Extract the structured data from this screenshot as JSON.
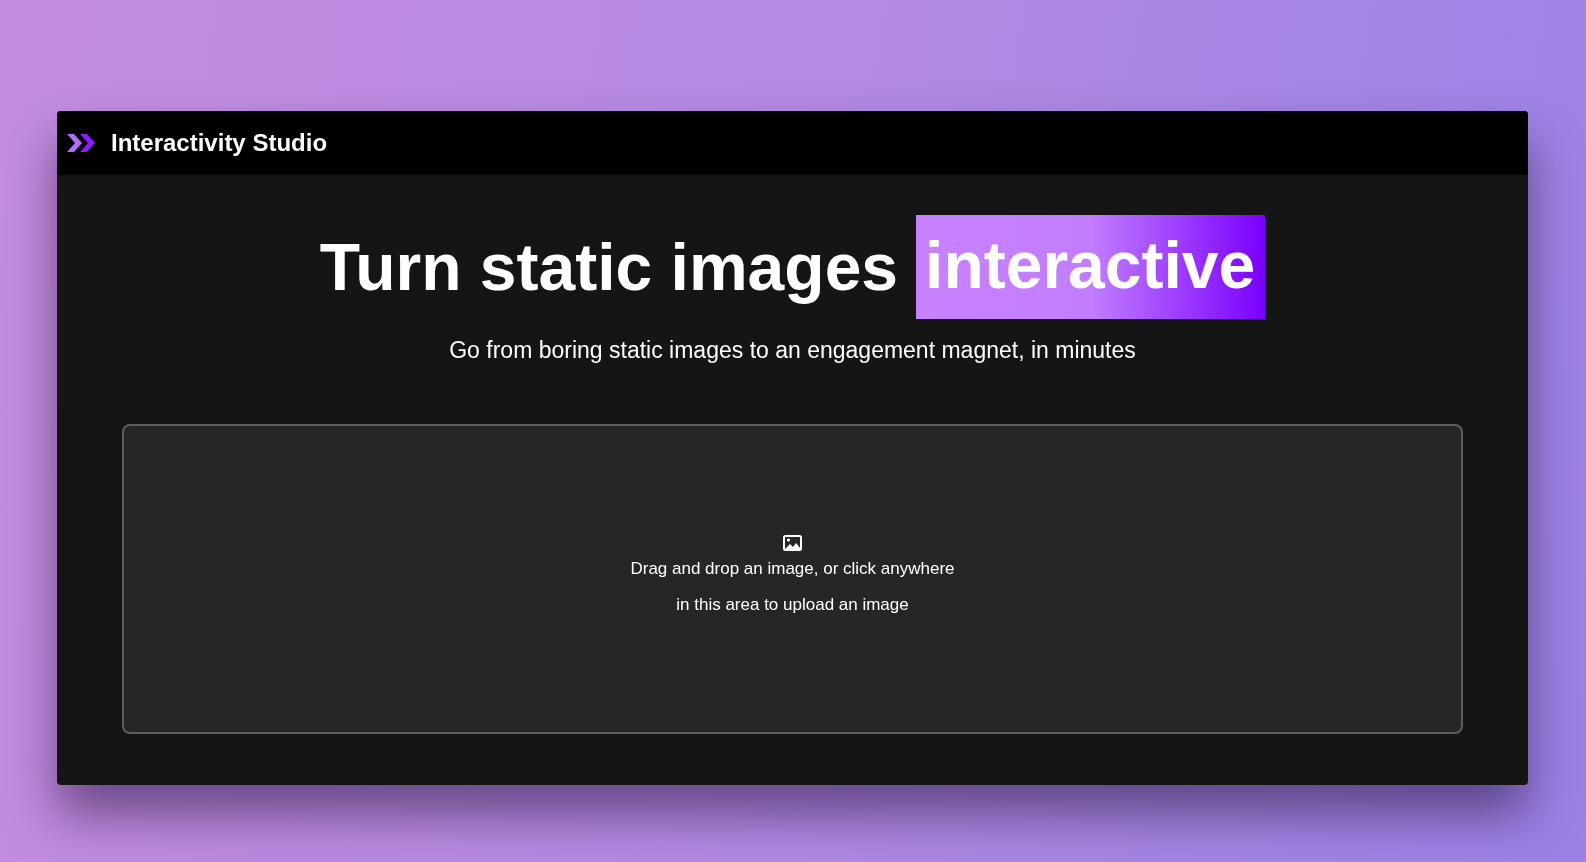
{
  "app": {
    "title": "Interactivity Studio"
  },
  "hero": {
    "headline": "Turn static images",
    "highlight": "interactive",
    "subtitle": "Go from boring static images to an engagement magnet, in minutes"
  },
  "upload": {
    "prompt": "Drag and drop an image, or click anywhere in this area to upload an image"
  }
}
